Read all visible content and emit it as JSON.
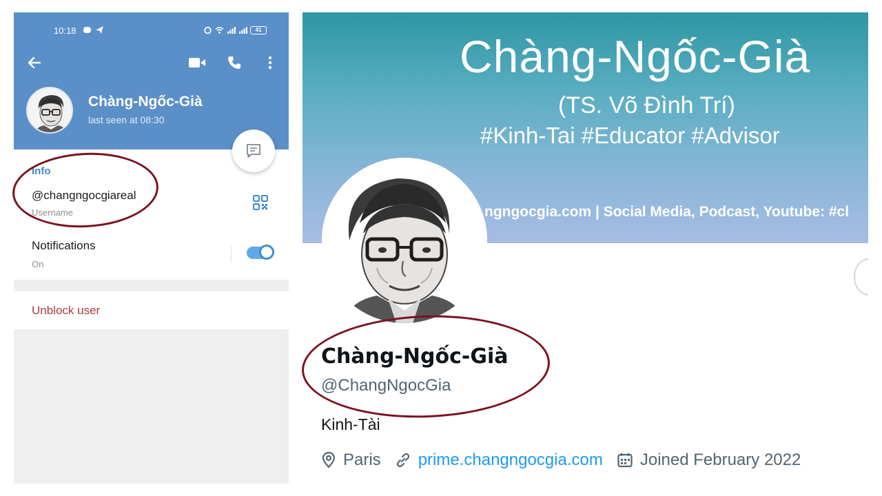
{
  "status_bar": {
    "time": "10:18",
    "battery": "41"
  },
  "telegram": {
    "name": "Chàng-Ngốc-Già",
    "last_seen": "last seen at 08:30",
    "info_label": "Info",
    "username": "@changngocgiareal",
    "username_label": "Username",
    "notifications_label": "Notifications",
    "notifications_state": "On",
    "notifications_enabled": true,
    "unblock_label": "Unblock user",
    "icons": [
      "back-arrow-icon",
      "video-call-icon",
      "phone-icon",
      "more-vertical-icon",
      "message-icon",
      "qr-code-icon"
    ]
  },
  "twitter": {
    "banner": {
      "title": "Chàng-Ngốc-Già",
      "subtitle": "(TS. Võ Đình Trí)",
      "hashtags": "#Kinh-Tai #Educator #Advisor",
      "links_line": "ngngocgia.com | Social Media, Podcast, Youtube: #cl"
    },
    "display_name": "Chàng-Ngốc-Già",
    "handle": "@ChangNgocGia",
    "bio": "Kinh-Tài",
    "location": "Paris",
    "website": "prime.changngocgia.com",
    "joined": "Joined February 2022",
    "icons": [
      "location-icon",
      "link-icon",
      "calendar-icon"
    ]
  },
  "colors": {
    "telegram_header": "#5b8fc7",
    "telegram_accent": "#3e8ac6",
    "unblock_red": "#b0393a",
    "annotation_ring": "#7a1220",
    "twitter_link": "#1d9bf0"
  }
}
